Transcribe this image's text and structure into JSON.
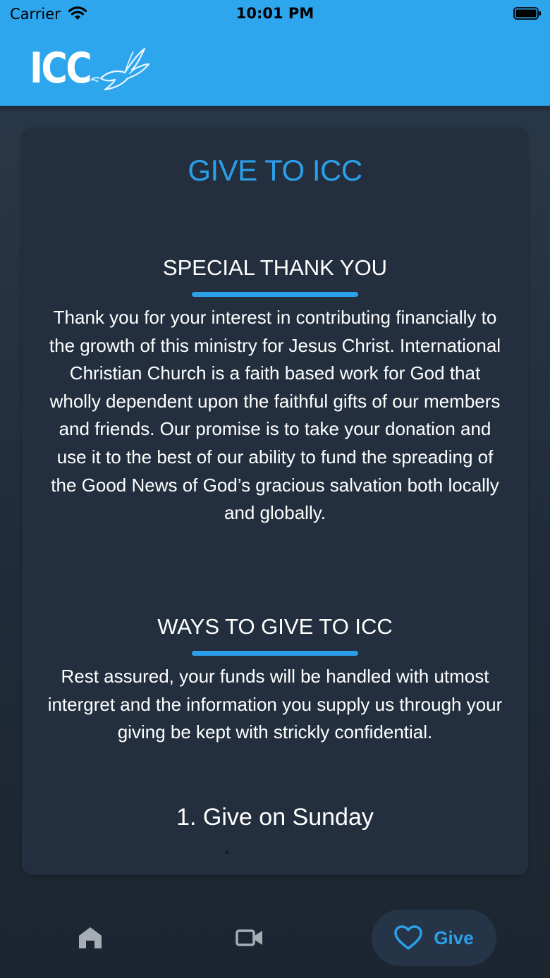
{
  "status_bar": {
    "carrier": "Carrier",
    "time": "10:01 PM"
  },
  "header": {
    "logo_text": "ICC"
  },
  "card": {
    "title": "GIVE TO ICC",
    "sections": [
      {
        "heading": "SPECIAL THANK YOU",
        "body": "Thank you for your interest in contributing financially to the growth of this ministry for Jesus Christ. International Christian Church is a faith based work for God that wholly dependent upon the faithful gifts of our members and friends. Our promise is to take your donation and use it to the best of our ability to fund the spreading of the Good News of God’s gracious salvation both locally and globally."
      },
      {
        "heading": "WAYS TO GIVE TO ICC",
        "body": "Rest  assured, your funds will be handled with utmost intergret and the information you supply us through your giving be kept with strickly confidential."
      }
    ],
    "give_option_1": "1. Give on Sunday"
  },
  "tab_bar": {
    "home_icon": "home-icon",
    "video_icon": "video-camera-icon",
    "give_icon": "heart-icon",
    "give_label": "Give",
    "active_color": "#2b9fe9",
    "inactive_color": "#a6adb5"
  },
  "colors": {
    "brand": "#2ea6ee",
    "accent": "#2b9fe9",
    "card_bg": "#232f3e"
  }
}
